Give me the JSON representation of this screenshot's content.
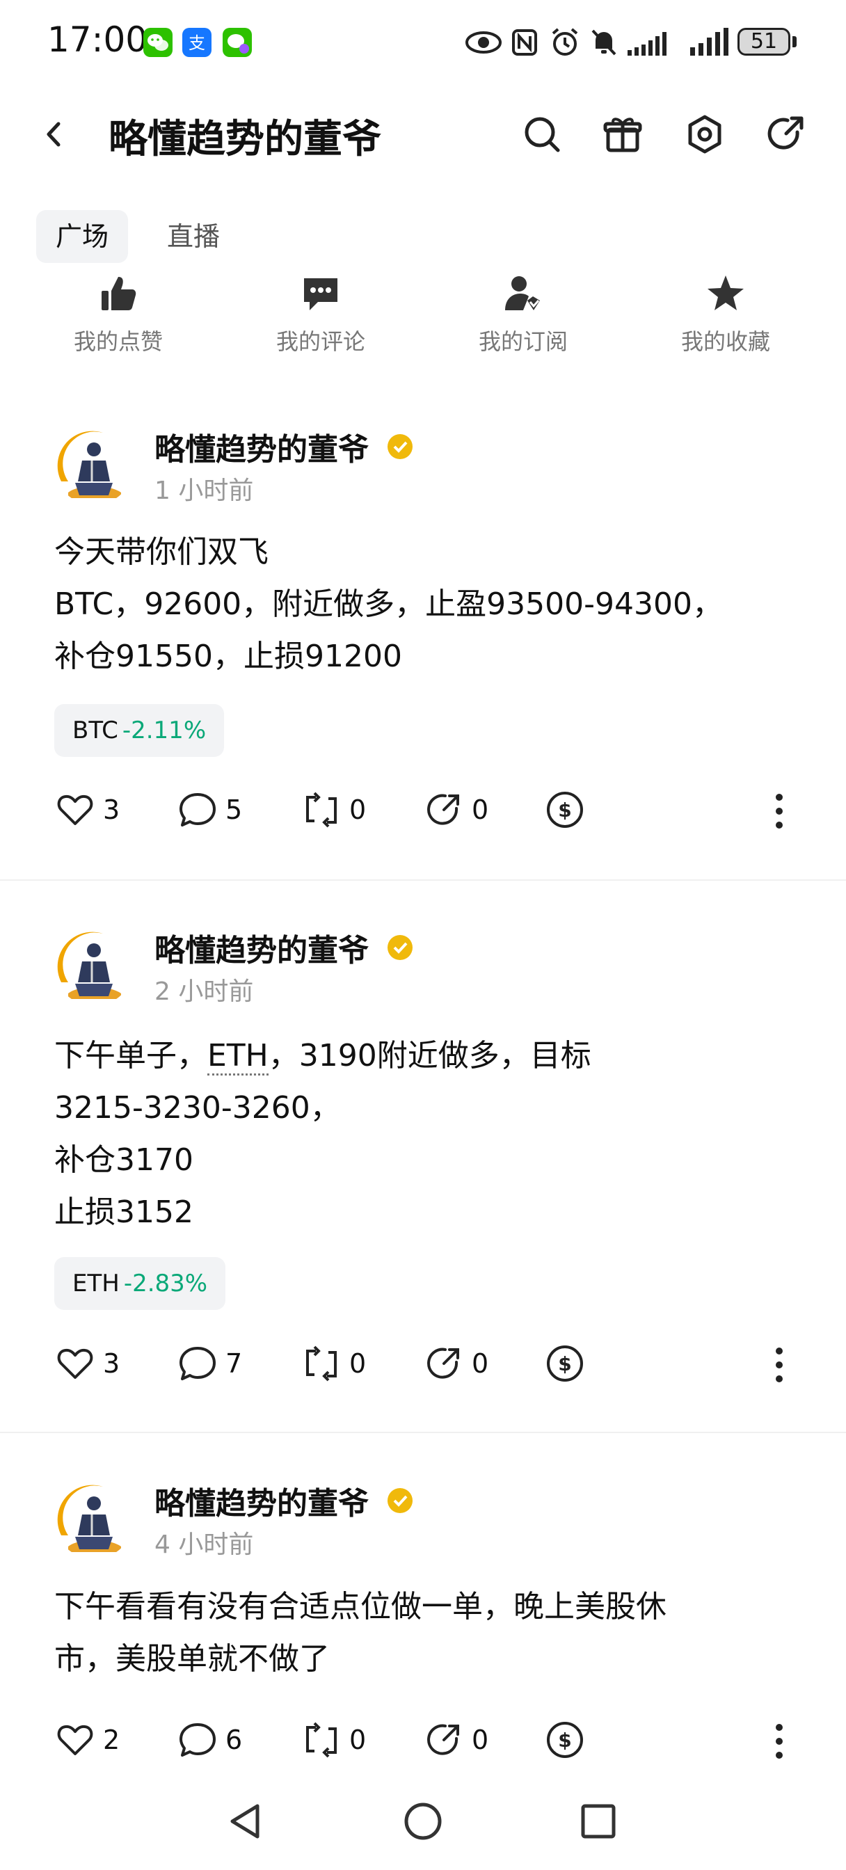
{
  "status_bar": {
    "time": "17:00",
    "battery": "51",
    "apps": [
      "wechat-icon",
      "alipay-icon",
      "chat-bubble-icon"
    ],
    "system_icons": [
      "eye-icon",
      "nfc-icon",
      "alarm-icon",
      "mute-icon",
      "signal-icon",
      "signal-icon"
    ]
  },
  "header": {
    "title": "略懂趋势的董爷",
    "actions": [
      "search-icon",
      "gift-icon",
      "settings-icon",
      "share-icon"
    ]
  },
  "tabs": [
    {
      "label": "广场",
      "active": true
    },
    {
      "label": "直播",
      "active": false
    }
  ],
  "quick_actions": [
    {
      "label": "我的点赞",
      "icon": "thumbs-up-icon"
    },
    {
      "label": "我的评论",
      "icon": "comment-icon"
    },
    {
      "label": "我的订阅",
      "icon": "subscription-icon"
    },
    {
      "label": "我的收藏",
      "icon": "star-icon"
    }
  ],
  "posts": [
    {
      "author": "略懂趋势的董爷",
      "time_ago": "1 小时前",
      "body": "今天带你们双飞\nBTC，92600，附近做多，止盈93500-94300，\n补仓91550，止损91200",
      "tag": {
        "symbol": "BTC",
        "change": "-2.11%"
      },
      "likes": "3",
      "comments": "5",
      "reposts": "0",
      "shares": "0"
    },
    {
      "author": "略懂趋势的董爷",
      "time_ago": "2 小时前",
      "body_prefix": "下午单子，",
      "body_link": "ETH",
      "body_rest": "，3190附近做多，目标\n3215-3230-3260，\n补仓3170\n止损3152",
      "tag": {
        "symbol": "ETH",
        "change": "-2.83%"
      },
      "likes": "3",
      "comments": "7",
      "reposts": "0",
      "shares": "0"
    },
    {
      "author": "略懂趋势的董爷",
      "time_ago": "4 小时前",
      "body": "下午看看有没有合适点位做一单，晚上美股休\n市，美股单就不做了",
      "likes": "2",
      "comments": "6",
      "reposts": "0",
      "shares": "0"
    }
  ],
  "colors": {
    "accent_green": "#0aa878",
    "verified_gold": "#f0b90b",
    "chip_bg": "#f2f3f5"
  }
}
